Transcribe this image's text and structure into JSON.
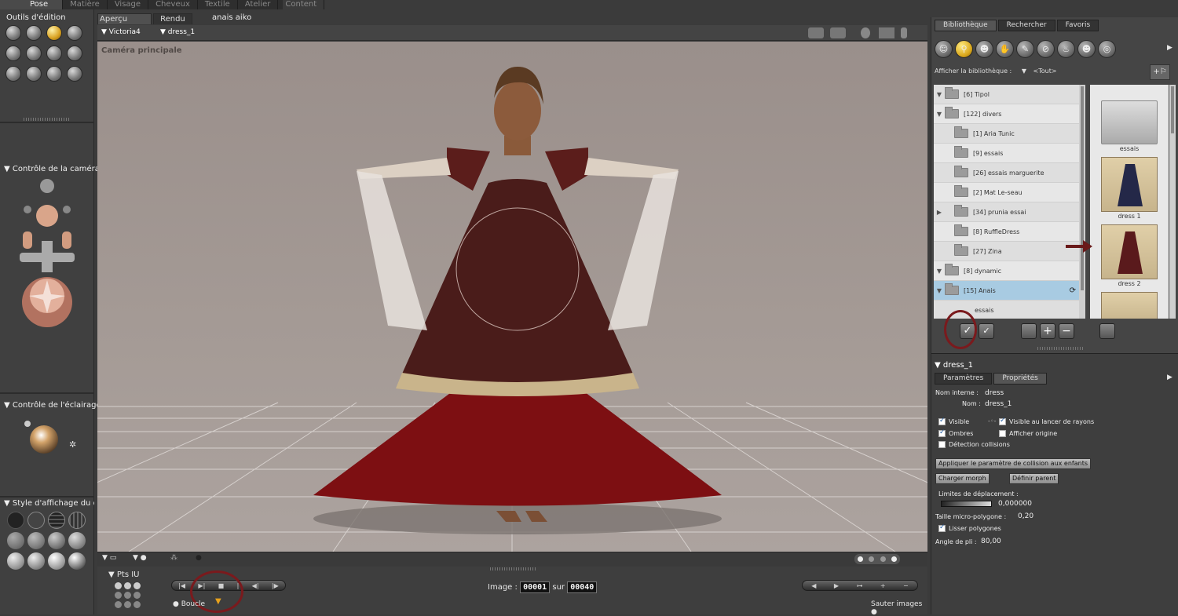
{
  "main_tabs": [
    "Pose",
    "Matière",
    "Visage",
    "Cheveux",
    "Textile",
    "Atelier",
    "Content"
  ],
  "left": {
    "tools_title": "Outils d'édition",
    "camera_title": "Contrôle de la caméra",
    "light_title": "Contrôle de l'éclairage",
    "style_title": "Style d'affichage du do"
  },
  "view_tabs": [
    "Aperçu",
    "Rendu"
  ],
  "document_name": "anais aiko",
  "figure_select": "Victoria4",
  "actor_select": "dress_1",
  "camera_label": "Caméra principale",
  "timeline": {
    "pts_label": "Pts IU",
    "image_label": "Image :",
    "frame_current": "00001",
    "frame_sep": "sur",
    "frame_total": "00040",
    "loop_label": "Boucle",
    "skip_label": "Sauter images"
  },
  "library": {
    "tabs": [
      "Bibliothèque",
      "Rechercher",
      "Favoris"
    ],
    "show_label": "Afficher la bibliothèque :",
    "filter_value": "<Tout>",
    "folders": [
      {
        "arrow": "▼",
        "label": "[6]   Tipol",
        "indent": 0
      },
      {
        "arrow": "▼",
        "label": "[122] divers",
        "indent": 0
      },
      {
        "arrow": "",
        "label": "[1]    Aria Tunic",
        "indent": 1
      },
      {
        "arrow": "",
        "label": "[9]    essais",
        "indent": 1
      },
      {
        "arrow": "",
        "label": "[26]   essais marguerite",
        "indent": 1
      },
      {
        "arrow": "",
        "label": "[2]    Mat Le-seau",
        "indent": 1
      },
      {
        "arrow": "▶",
        "label": "[34]   prunia essai",
        "indent": 1
      },
      {
        "arrow": "",
        "label": "[8]    RuffleDress",
        "indent": 1
      },
      {
        "arrow": "",
        "label": "[27]   Zina",
        "indent": 1
      },
      {
        "arrow": "▼",
        "label": "[8]    dynamic",
        "indent": 1
      },
      {
        "arrow": "▼",
        "label": "[15]   Anais",
        "indent": 1
      },
      {
        "arrow": "",
        "label": "essais",
        "indent": 2
      }
    ],
    "thumbs": [
      "essais",
      "dress 1",
      "dress 2"
    ]
  },
  "props": {
    "actor": "dress_1",
    "tabs": [
      "Paramètres",
      "Propriétés"
    ],
    "internal_label": "Nom interne :",
    "internal_value": "dress",
    "name_label": "Nom :",
    "name_value": "dress_1",
    "visible": "Visible",
    "visible_ray": "Visible au lancer de rayons",
    "shadows": "Ombres",
    "show_origin": "Afficher origine",
    "collision": "Détection collisions",
    "apply_collision_btn": "Appliquer le paramètre de collision aux enfants",
    "load_morph_btn": "Charger morph",
    "set_parent_btn": "Définir parent",
    "displacement_label": "Limites de déplacement :",
    "displacement_value": "0,000000",
    "micropoly_label": "Taille micro-polygone :",
    "micropoly_value": "0,20",
    "smooth_label": "Lisser polygones",
    "crease_label": "Angle de pli :",
    "crease_value": "80,00"
  }
}
